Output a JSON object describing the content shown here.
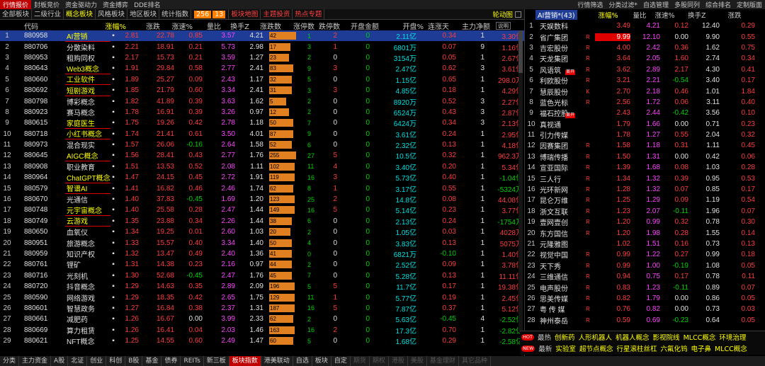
{
  "top_menu": {
    "left": [
      "行情报价",
      "封板竞价",
      "资金驱动力",
      "资金搏弈",
      "DDE排名"
    ],
    "active_index": 0,
    "right": [
      "行情筛选",
      "分类过滤*",
      "自选管理",
      "多股同列",
      "综合排名",
      "定制版面"
    ]
  },
  "tabs": [
    "全部板块",
    "二级行业",
    "概念板块",
    "风格板块",
    "地区板块",
    "统计指数"
  ],
  "tab_selected_index": 2,
  "tab_badge": [
    "256",
    "13"
  ],
  "tab_extra": [
    "板块地图",
    "主题投资",
    "热点专题"
  ],
  "rotate_label": "轮动图",
  "columns": [
    "代码",
    "涨幅%",
    "涨跌",
    "涨速%",
    "量比",
    "换手Z",
    "涨跌数",
    "涨停数",
    "跌停数",
    "开盘金额",
    "开盘%",
    "连涨天",
    "主力净额"
  ],
  "upbtn_label": "说明",
  "rows": [
    {
      "idx": "1",
      "code": "880958",
      "name": "AI营销",
      "pct": "2.81",
      "chg": "22.78",
      "spd": "0.85",
      "vol": "3.57",
      "to": "4.21",
      "up": "42",
      "upw": 0.95,
      "dn": "1",
      "stop": "2",
      "dstop": "0",
      "amt": "2.11亿",
      "oprt": "0.34",
      "days": "1",
      "net": "3.30亿",
      "ul": true,
      "sel": true
    },
    {
      "idx": "2",
      "code": "880706",
      "name": "分散染料",
      "pct": "2.21",
      "chg": "18.91",
      "spd": "0.21",
      "vol": "5.73",
      "to": "2.98",
      "up": "17",
      "upw": 0.75,
      "dn": "3",
      "stop": "1",
      "dstop": "0",
      "amt": "6801万",
      "oprt": "0.07",
      "days": "9",
      "net": "1.16亿",
      "ul": false
    },
    {
      "idx": "3",
      "code": "880953",
      "name": "租购同权",
      "pct": "2.17",
      "chg": "15.73",
      "spd": "0.21",
      "vol": "3.59",
      "to": "1.27",
      "up": "23",
      "upw": 0.7,
      "dn": "2",
      "stop": "0",
      "dstop": "0",
      "amt": "3154万",
      "oprt": "0.05",
      "days": "1",
      "net": "2.67亿",
      "ul": false
    },
    {
      "idx": "4",
      "code": "880643",
      "name": "Web3概念",
      "pct": "1.91",
      "chg": "29.84",
      "spd": "0.58",
      "vol": "2.77",
      "to": "2.41",
      "up": "83",
      "upw": 0.85,
      "dn": "9",
      "stop": "3",
      "dstop": "0",
      "amt": "2.47亿",
      "oprt": "0.62",
      "days": "3",
      "net": "3.61亿",
      "ul": true
    },
    {
      "idx": "5",
      "code": "880660",
      "name": "工业软件",
      "pct": "1.89",
      "chg": "25.27",
      "spd": "0.09",
      "vol": "2.43",
      "to": "1.17",
      "up": "32",
      "upw": 0.8,
      "dn": "5",
      "stop": "0",
      "dstop": "0",
      "amt": "1.15亿",
      "oprt": "0.65",
      "days": "1",
      "net": "298.0万",
      "ul": true
    },
    {
      "idx": "6",
      "code": "880692",
      "name": "短剧游戏",
      "pct": "1.85",
      "chg": "21.79",
      "spd": "0.60",
      "vol": "3.34",
      "to": "2.41",
      "up": "31",
      "upw": 0.8,
      "dn": "3",
      "stop": "3",
      "dstop": "0",
      "amt": "4.85亿",
      "oprt": "0.18",
      "days": "1",
      "net": "4.29亿",
      "ul": true
    },
    {
      "idx": "7",
      "code": "880798",
      "name": "博彩概念",
      "pct": "1.82",
      "chg": "41.89",
      "spd": "0.39",
      "vol": "3.63",
      "to": "1.62",
      "up": "5",
      "upw": 0.6,
      "dn": "2",
      "stop": "0",
      "dstop": "0",
      "amt": "8920万",
      "oprt": "0.52",
      "days": "3",
      "net": "2.27亿",
      "ul": false
    },
    {
      "idx": "8",
      "code": "880923",
      "name": "赛马概念",
      "pct": "1.78",
      "chg": "16.91",
      "spd": "0.39",
      "vol": "3.26",
      "to": "0.97",
      "up": "12",
      "upw": 0.7,
      "dn": "2",
      "stop": "0",
      "dstop": "0",
      "amt": "6524万",
      "oprt": "0.43",
      "days": "3",
      "net": "2.87亿",
      "ul": false
    },
    {
      "idx": "9",
      "code": "880615",
      "name": "家庭医生",
      "pct": "1.75",
      "chg": "19.26",
      "spd": "0.42",
      "vol": "2.78",
      "to": "1.18",
      "up": "50",
      "upw": 0.85,
      "dn": "7",
      "stop": "0",
      "dstop": "0",
      "amt": "6424万",
      "oprt": "0.34",
      "days": "3",
      "net": "2.13亿",
      "ul": true
    },
    {
      "idx": "10",
      "code": "880718",
      "name": "小红书概念",
      "pct": "1.74",
      "chg": "21.41",
      "spd": "0.61",
      "vol": "3.50",
      "to": "4.01",
      "up": "87",
      "upw": 0.85,
      "dn": "9",
      "stop": "0",
      "dstop": "0",
      "amt": "3.61亿",
      "oprt": "0.24",
      "days": "1",
      "net": "2.95亿",
      "ul": true
    },
    {
      "idx": "11",
      "code": "880973",
      "name": "混合现实",
      "pct": "1.57",
      "chg": "26.06",
      "spd": "-0.16",
      "vol": "2.64",
      "to": "1.58",
      "up": "52",
      "upw": 0.8,
      "dn": "6",
      "stop": "0",
      "dstop": "0",
      "amt": "2.32亿",
      "oprt": "0.13",
      "days": "1",
      "net": "4.18亿",
      "ul": false
    },
    {
      "idx": "12",
      "code": "880645",
      "name": "AIGC概念",
      "pct": "1.56",
      "chg": "28.41",
      "spd": "0.43",
      "vol": "2.77",
      "to": "1.76",
      "up": "255",
      "upw": 0.95,
      "dn": "27",
      "stop": "5",
      "dstop": "0",
      "amt": "10.5亿",
      "oprt": "0.32",
      "days": "1",
      "net": "962.3万",
      "ul": true
    },
    {
      "idx": "13",
      "code": "880908",
      "name": "职业教育",
      "pct": "1.51",
      "chg": "13.53",
      "spd": "0.52",
      "vol": "2.08",
      "to": "1.11",
      "up": "102",
      "upw": 0.9,
      "dn": "11",
      "stop": "4",
      "dstop": "0",
      "amt": "3.40亿",
      "oprt": "0.20",
      "days": "1",
      "net": "5.34亿",
      "ul": false
    },
    {
      "idx": "14",
      "code": "880964",
      "name": "ChatGPT概念",
      "pct": "1.47",
      "chg": "24.15",
      "spd": "0.45",
      "vol": "2.72",
      "to": "1.91",
      "up": "119",
      "upw": 0.9,
      "dn": "16",
      "stop": "3",
      "dstop": "0",
      "amt": "5.73亿",
      "oprt": "0.40",
      "days": "1",
      "net": "-1.04亿",
      "ul": true
    },
    {
      "idx": "15",
      "code": "880579",
      "name": "智谱AI",
      "pct": "1.41",
      "chg": "16.82",
      "spd": "0.46",
      "vol": "2.46",
      "to": "1.74",
      "up": "62",
      "upw": 0.85,
      "dn": "8",
      "stop": "1",
      "dstop": "0",
      "amt": "3.17亿",
      "oprt": "0.55",
      "days": "1",
      "net": "-5324万",
      "ul": true
    },
    {
      "idx": "16",
      "code": "880670",
      "name": "光通信",
      "pct": "1.40",
      "chg": "37.83",
      "spd": "-0.45",
      "vol": "1.69",
      "to": "1.20",
      "up": "123",
      "upw": 0.9,
      "dn": "25",
      "stop": "2",
      "dstop": "0",
      "amt": "14.8亿",
      "oprt": "0.08",
      "days": "1",
      "net": "44.08亿",
      "ul": false
    },
    {
      "idx": "17",
      "code": "880748",
      "name": "元宇宙概念",
      "pct": "1.40",
      "chg": "25.58",
      "spd": "0.28",
      "vol": "2.47",
      "to": "1.44",
      "up": "149",
      "upw": 0.9,
      "dn": "16",
      "stop": "5",
      "dstop": "0",
      "amt": "5.14亿",
      "oprt": "0.23",
      "days": "1",
      "net": "3.77亿",
      "ul": true
    },
    {
      "idx": "18",
      "code": "880749",
      "name": "云游戏",
      "pct": "1.35",
      "chg": "23.88",
      "spd": "0.34",
      "vol": "2.26",
      "to": "1.44",
      "up": "38",
      "upw": 0.8,
      "dn": "6",
      "stop": "0",
      "dstop": "0",
      "amt": "2.13亿",
      "oprt": "0.24",
      "days": "1",
      "net": "-1754万",
      "ul": true
    },
    {
      "idx": "19",
      "code": "880650",
      "name": "血氧仪",
      "pct": "1.34",
      "chg": "19.25",
      "spd": "0.01",
      "vol": "2.60",
      "to": "1.03",
      "up": "20",
      "upw": 0.75,
      "dn": "2",
      "stop": "0",
      "dstop": "0",
      "amt": "1.05亿",
      "oprt": "0.03",
      "days": "1",
      "net": "4028万",
      "ul": false
    },
    {
      "idx": "20",
      "code": "880951",
      "name": "旅游概念",
      "pct": "1.33",
      "chg": "15.57",
      "spd": "0.40",
      "vol": "3.34",
      "to": "1.40",
      "up": "50",
      "upw": 0.8,
      "dn": "4",
      "stop": "0",
      "dstop": "0",
      "amt": "3.83亿",
      "oprt": "0.13",
      "days": "1",
      "net": "5075万",
      "ul": false
    },
    {
      "idx": "21",
      "code": "880959",
      "name": "知识产权",
      "pct": "1.32",
      "chg": "13.47",
      "spd": "0.49",
      "vol": "2.40",
      "to": "1.36",
      "up": "41",
      "upw": 0.8,
      "dn": "0",
      "stop": "0",
      "dstop": "0",
      "amt": "6821万",
      "oprt": "-0.10",
      "days": "1",
      "net": "1.40亿",
      "ul": false
    },
    {
      "idx": "22",
      "code": "880761",
      "name": "锂矿",
      "pct": "1.31",
      "chg": "14.38",
      "spd": "0.23",
      "vol": "2.16",
      "to": "0.97",
      "up": "44",
      "upw": 0.8,
      "dn": "2",
      "stop": "0",
      "dstop": "0",
      "amt": "2.52亿",
      "oprt": "0.09",
      "days": "1",
      "net": "3.78亿",
      "ul": false
    },
    {
      "idx": "23",
      "code": "880716",
      "name": "光刻机",
      "pct": "1.30",
      "chg": "52.68",
      "spd": "-0.45",
      "vol": "2.47",
      "to": "1.76",
      "up": "45",
      "upw": 0.8,
      "dn": "7",
      "stop": "0",
      "dstop": "0",
      "amt": "5.28亿",
      "oprt": "0.13",
      "days": "1",
      "net": "11.11亿",
      "ul": false
    },
    {
      "idx": "24",
      "code": "880720",
      "name": "抖音概念",
      "pct": "1.29",
      "chg": "14.63",
      "spd": "0.35",
      "vol": "2.89",
      "to": "2.09",
      "up": "196",
      "upw": 0.9,
      "dn": "5",
      "stop": "5",
      "dstop": "0",
      "amt": "11.7亿",
      "oprt": "0.17",
      "days": "1",
      "net": "19.38亿",
      "ul": false
    },
    {
      "idx": "25",
      "code": "880590",
      "name": "网络游戏",
      "pct": "1.29",
      "chg": "18.35",
      "spd": "0.42",
      "vol": "2.65",
      "to": "1.75",
      "up": "129",
      "upw": 0.9,
      "dn": "11",
      "stop": "1",
      "dstop": "0",
      "amt": "5.77亿",
      "oprt": "0.19",
      "days": "1",
      "net": "2.45亿",
      "ul": false
    },
    {
      "idx": "26",
      "code": "880601",
      "name": "智慧政务",
      "pct": "1.27",
      "chg": "16.84",
      "spd": "0.38",
      "vol": "2.37",
      "to": "1.31",
      "up": "187",
      "upw": 0.9,
      "dn": "16",
      "stop": "5",
      "dstop": "0",
      "amt": "7.87亿",
      "oprt": "0.37",
      "days": "1",
      "net": "5.12亿",
      "ul": false
    },
    {
      "idx": "27",
      "code": "880661",
      "name": "减肥药",
      "pct": "1.26",
      "chg": "16.67",
      "spd": "0.00",
      "vol": "3.99",
      "to": "2.33",
      "up": "62",
      "upw": 0.85,
      "dn": "2",
      "stop": "0",
      "dstop": "0",
      "amt": "5.63亿",
      "oprt": "-0.45",
      "days": "4",
      "net": "-2.52亿",
      "ul": false
    },
    {
      "idx": "28",
      "code": "880669",
      "name": "算力租赁",
      "pct": "1.26",
      "chg": "16.41",
      "spd": "0.04",
      "vol": "2.03",
      "to": "1.46",
      "up": "163",
      "upw": 0.9,
      "dn": "16",
      "stop": "2",
      "dstop": "0",
      "amt": "17.3亿",
      "oprt": "0.70",
      "days": "1",
      "net": "-2.82亿",
      "ul": false
    },
    {
      "idx": "29",
      "code": "880621",
      "name": "NFT概念",
      "pct": "1.25",
      "chg": "14.55",
      "spd": "0.60",
      "vol": "2.49",
      "to": "1.47",
      "up": "60",
      "upw": 0.85,
      "dn": "5",
      "stop": "0",
      "dstop": "0",
      "amt": "1.68亿",
      "oprt": "0.29",
      "days": "1",
      "net": "-2.58亿",
      "ul": false
    }
  ],
  "right_header": {
    "title": "AI营销*(43)",
    "cols": [
      "涨幅%",
      "量比",
      "涨速%",
      "换手Z",
      "涨跌"
    ]
  },
  "right_rows": [
    {
      "idx": "1",
      "name": "天娱数科",
      "fl": "",
      "pct": "3.49",
      "vol": "4.21",
      "spd": "0.12",
      "to": "12.40",
      "chg": "0.29",
      "tag": ""
    },
    {
      "idx": "2",
      "name": "省广集团",
      "fl": "R",
      "pct": "9.99",
      "vol": "12.10",
      "spd": "0.00",
      "to": "9.90",
      "chg": "0.55",
      "tag": "",
      "hl": true
    },
    {
      "idx": "3",
      "name": "吉宏股份",
      "fl": "R",
      "pct": "4.00",
      "vol": "2.42",
      "spd": "0.36",
      "to": "1.62",
      "chg": "0.75",
      "tag": ""
    },
    {
      "idx": "4",
      "name": "天龙集团",
      "fl": "R",
      "pct": "3.64",
      "vol": "2.05",
      "spd": "1.60",
      "to": "2.74",
      "chg": "0.34",
      "tag": ""
    },
    {
      "idx": "5",
      "name": "风语筑",
      "fl": "R",
      "pct": "3.62",
      "vol": "2.89",
      "spd": "2.17",
      "to": "4.30",
      "chg": "0.41",
      "tag": "首开"
    },
    {
      "idx": "6",
      "name": "利欧股份",
      "fl": "R",
      "pct": "3.21",
      "vol": "2.21",
      "spd": "-0.54",
      "to": "3.40",
      "chg": "0.17",
      "tag": ""
    },
    {
      "idx": "7",
      "name": "慧辰股份",
      "fl": "K",
      "pct": "2.70",
      "vol": "2.18",
      "spd": "0.46",
      "to": "1.01",
      "chg": "1.84",
      "tag": ""
    },
    {
      "idx": "8",
      "name": "蓝色光标",
      "fl": "R",
      "pct": "2.56",
      "vol": "1.72",
      "spd": "0.06",
      "to": "3.11",
      "chg": "0.40",
      "tag": ""
    },
    {
      "idx": "9",
      "name": "福石控股",
      "fl": "",
      "pct": "2.43",
      "vol": "2.44",
      "spd": "-0.42",
      "to": "3.56",
      "chg": "0.10",
      "tag": "首开"
    },
    {
      "idx": "10",
      "name": "真视通",
      "fl": "",
      "pct": "1.79",
      "vol": "1.66",
      "spd": "0.00",
      "to": "0.71",
      "chg": "0.23",
      "tag": ""
    },
    {
      "idx": "11",
      "name": "引力传媒",
      "fl": "",
      "pct": "1.78",
      "vol": "1.27",
      "spd": "0.55",
      "to": "2.04",
      "chg": "0.32",
      "tag": ""
    },
    {
      "idx": "12",
      "name": "因赛集团",
      "fl": "R",
      "pct": "1.58",
      "vol": "1.18",
      "spd": "0.31",
      "to": "1.11",
      "chg": "0.45",
      "tag": ""
    },
    {
      "idx": "13",
      "name": "博瑞传播",
      "fl": "R",
      "pct": "1.50",
      "vol": "1.31",
      "spd": "0.00",
      "to": "0.42",
      "chg": "0.06",
      "tag": ""
    },
    {
      "idx": "14",
      "name": "宣亚国际",
      "fl": "R",
      "pct": "1.39",
      "vol": "1.68",
      "spd": "0.08",
      "to": "1.03",
      "chg": "0.28",
      "tag": ""
    },
    {
      "idx": "15",
      "name": "三人行",
      "fl": "R",
      "pct": "1.34",
      "vol": "1.32",
      "spd": "0.39",
      "to": "0.95",
      "chg": "0.53",
      "tag": ""
    },
    {
      "idx": "16",
      "name": "光环新网",
      "fl": "R",
      "pct": "1.28",
      "vol": "1.32",
      "spd": "0.07",
      "to": "0.85",
      "chg": "0.17",
      "tag": ""
    },
    {
      "idx": "17",
      "name": "昆仑万维",
      "fl": "R",
      "pct": "1.25",
      "vol": "1.29",
      "spd": "0.09",
      "to": "1.19",
      "chg": "0.54",
      "tag": ""
    },
    {
      "idx": "18",
      "name": "浙文互联",
      "fl": "R",
      "pct": "1.23",
      "vol": "2.07",
      "spd": "-0.11",
      "to": "1.96",
      "chg": "0.07",
      "tag": ""
    },
    {
      "idx": "19",
      "name": "壹网壹创",
      "fl": "R",
      "pct": "1.20",
      "vol": "0.99",
      "spd": "0.32",
      "to": "0.78",
      "chg": "0.30",
      "tag": ""
    },
    {
      "idx": "20",
      "name": "东方国信",
      "fl": "R",
      "pct": "1.20",
      "vol": "1.98",
      "spd": "0.28",
      "to": "1.55",
      "chg": "0.14",
      "tag": ""
    },
    {
      "idx": "21",
      "name": "元隆雅图",
      "fl": "",
      "pct": "1.02",
      "vol": "1.51",
      "spd": "0.16",
      "to": "0.73",
      "chg": "0.13",
      "tag": ""
    },
    {
      "idx": "22",
      "name": "视觉中国",
      "fl": "R",
      "pct": "0.99",
      "vol": "1.22",
      "spd": "0.27",
      "to": "0.99",
      "chg": "0.18",
      "tag": ""
    },
    {
      "idx": "23",
      "name": "天下秀",
      "fl": "R",
      "pct": "0.99",
      "vol": "1.00",
      "spd": "-0.19",
      "to": "1.08",
      "chg": "0.05",
      "tag": ""
    },
    {
      "idx": "24",
      "name": "三维通信",
      "fl": "R",
      "pct": "0.94",
      "vol": "0.75",
      "spd": "0.17",
      "to": "0.78",
      "chg": "0.11",
      "tag": ""
    },
    {
      "idx": "25",
      "name": "电声股份",
      "fl": "R",
      "pct": "0.83",
      "vol": "1.23",
      "spd": "-0.11",
      "to": "0.89",
      "chg": "0.07",
      "tag": ""
    },
    {
      "idx": "26",
      "name": "思美传媒",
      "fl": "R",
      "pct": "0.82",
      "vol": "1.79",
      "spd": "0.00",
      "to": "0.86",
      "chg": "0.05",
      "tag": ""
    },
    {
      "idx": "27",
      "name": "粤 传 媒",
      "fl": "R",
      "pct": "0.76",
      "vol": "0.82",
      "spd": "0.00",
      "to": "0.73",
      "chg": "0.03",
      "tag": ""
    },
    {
      "idx": "28",
      "name": "神州泰岳",
      "fl": "R",
      "pct": "0.59",
      "vol": "0.69",
      "spd": "-0.23",
      "to": "0.64",
      "chg": "0.05",
      "tag": ""
    }
  ],
  "hot": {
    "icon1": "HOT",
    "label1": "最热",
    "items1": [
      "创新药",
      "人形机器人",
      "机器人概念",
      "影视院线",
      "MLCC概念",
      "环境治理"
    ],
    "icon2": "NEW",
    "label2": "最新",
    "items2": [
      "实验室",
      "超节点概念",
      "行星滚柱丝杠",
      "六氟化钨",
      "电子鼻",
      "MLCC概念"
    ]
  },
  "bottom_tabs": [
    "分类",
    "主力资金",
    "A股",
    "北证",
    "创业",
    "科创",
    "B股",
    "基金",
    "债券",
    "REITs",
    "新三板",
    "板块指数",
    "港美联动",
    "自选",
    "板块",
    "自定",
    "期货",
    "期权",
    "港股",
    "美股",
    "基金理财",
    "其它品种"
  ],
  "bottom_selected_index": 11
}
